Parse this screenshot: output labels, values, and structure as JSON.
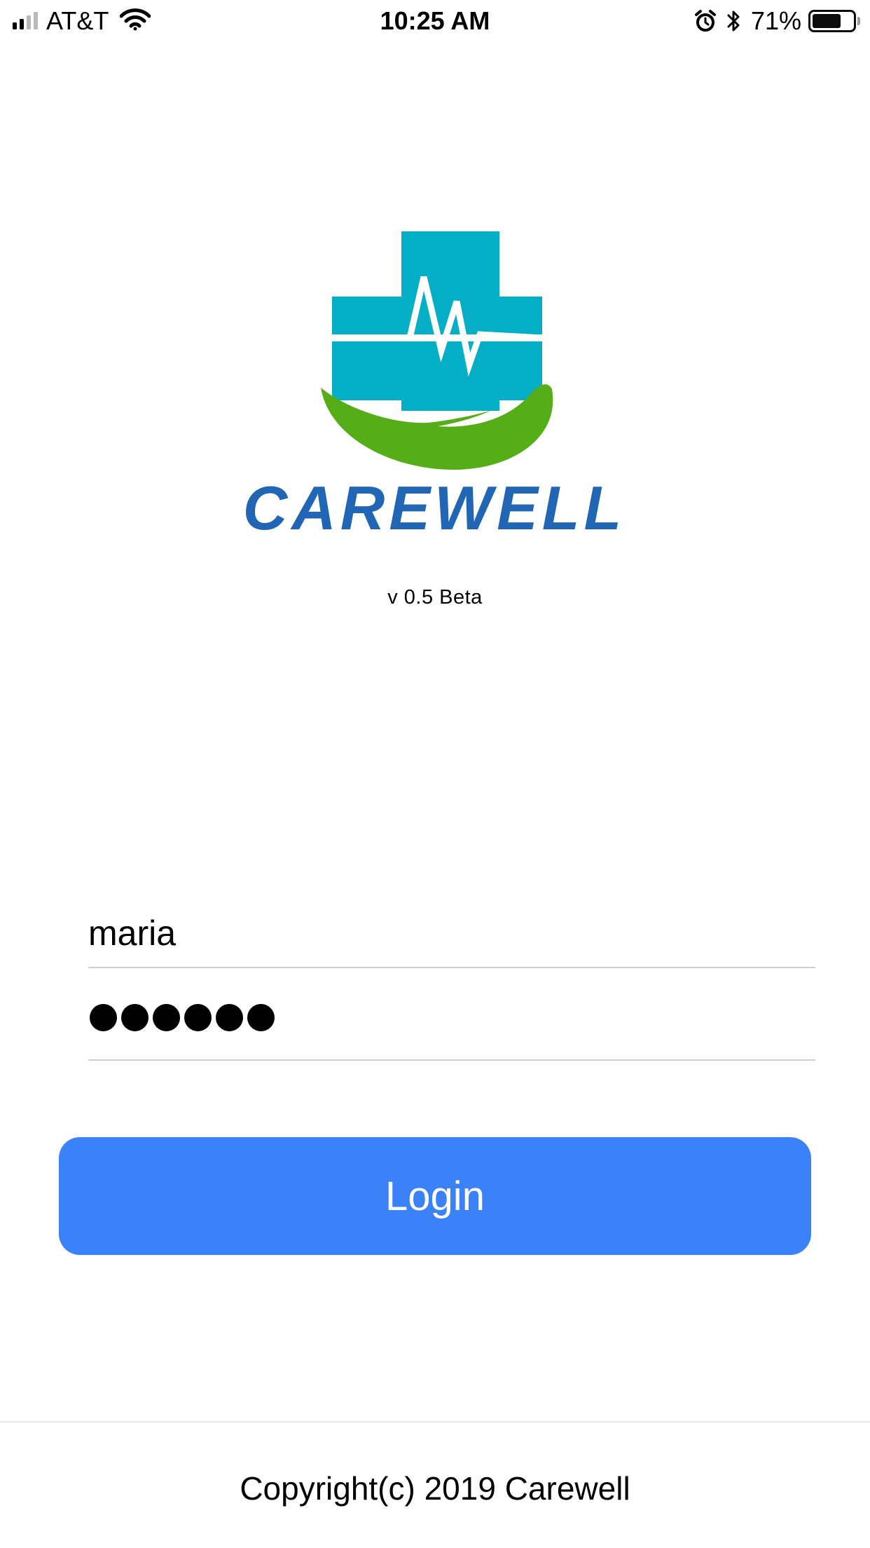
{
  "status_bar": {
    "carrier": "AT&T",
    "time": "10:25 AM",
    "battery_percent": "71%",
    "battery_level": 0.71,
    "signal_bars_active": 2,
    "signal_bars_total": 4,
    "icons": [
      "signal-icon",
      "wifi-icon",
      "alarm-icon",
      "bluetooth-icon",
      "battery-icon"
    ]
  },
  "logo": {
    "wordmark": "CAREWELL",
    "colors": {
      "cross": "#04aec5",
      "hand": "#55ae17",
      "wordmark": "#2166b5"
    }
  },
  "app": {
    "version": "v 0.5 Beta"
  },
  "login_form": {
    "username_value": "maria",
    "password_length": 6,
    "login_label": "Login",
    "button_color": "#3b82f8"
  },
  "footer": {
    "copyright": "Copyright(c) 2019 Carewell"
  }
}
